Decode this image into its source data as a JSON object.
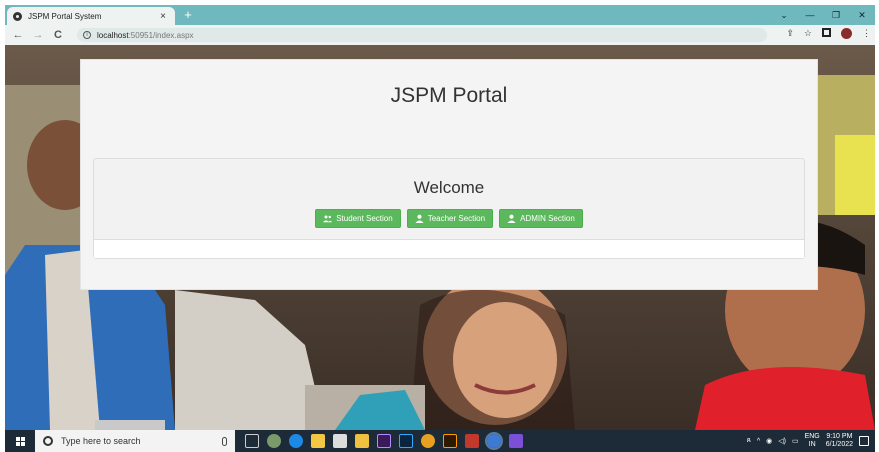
{
  "browser": {
    "tab_title": "JSPM Portal System",
    "tab_close": "×",
    "new_tab": "+",
    "url_host": "localhost",
    "url_path": ":50951/index.aspx",
    "back": "←",
    "forward": "→",
    "reload": "C",
    "window_controls": {
      "minimize": "⌄",
      "min2": "—",
      "restore": "❐",
      "close": "✕"
    }
  },
  "page": {
    "heading": "JSPM Portal",
    "welcome": "Welcome",
    "buttons": [
      {
        "label": "Student Section",
        "icon": "users-icon"
      },
      {
        "label": "Teacher Section",
        "icon": "user-icon"
      },
      {
        "label": "ADMIN Section",
        "icon": "user-icon"
      }
    ],
    "button_color": "#5cb85c"
  },
  "taskbar": {
    "search_placeholder": "Type here to search",
    "lang": "ENG",
    "region": "IN",
    "time": "9:10 PM",
    "date": "6/1/2022"
  }
}
